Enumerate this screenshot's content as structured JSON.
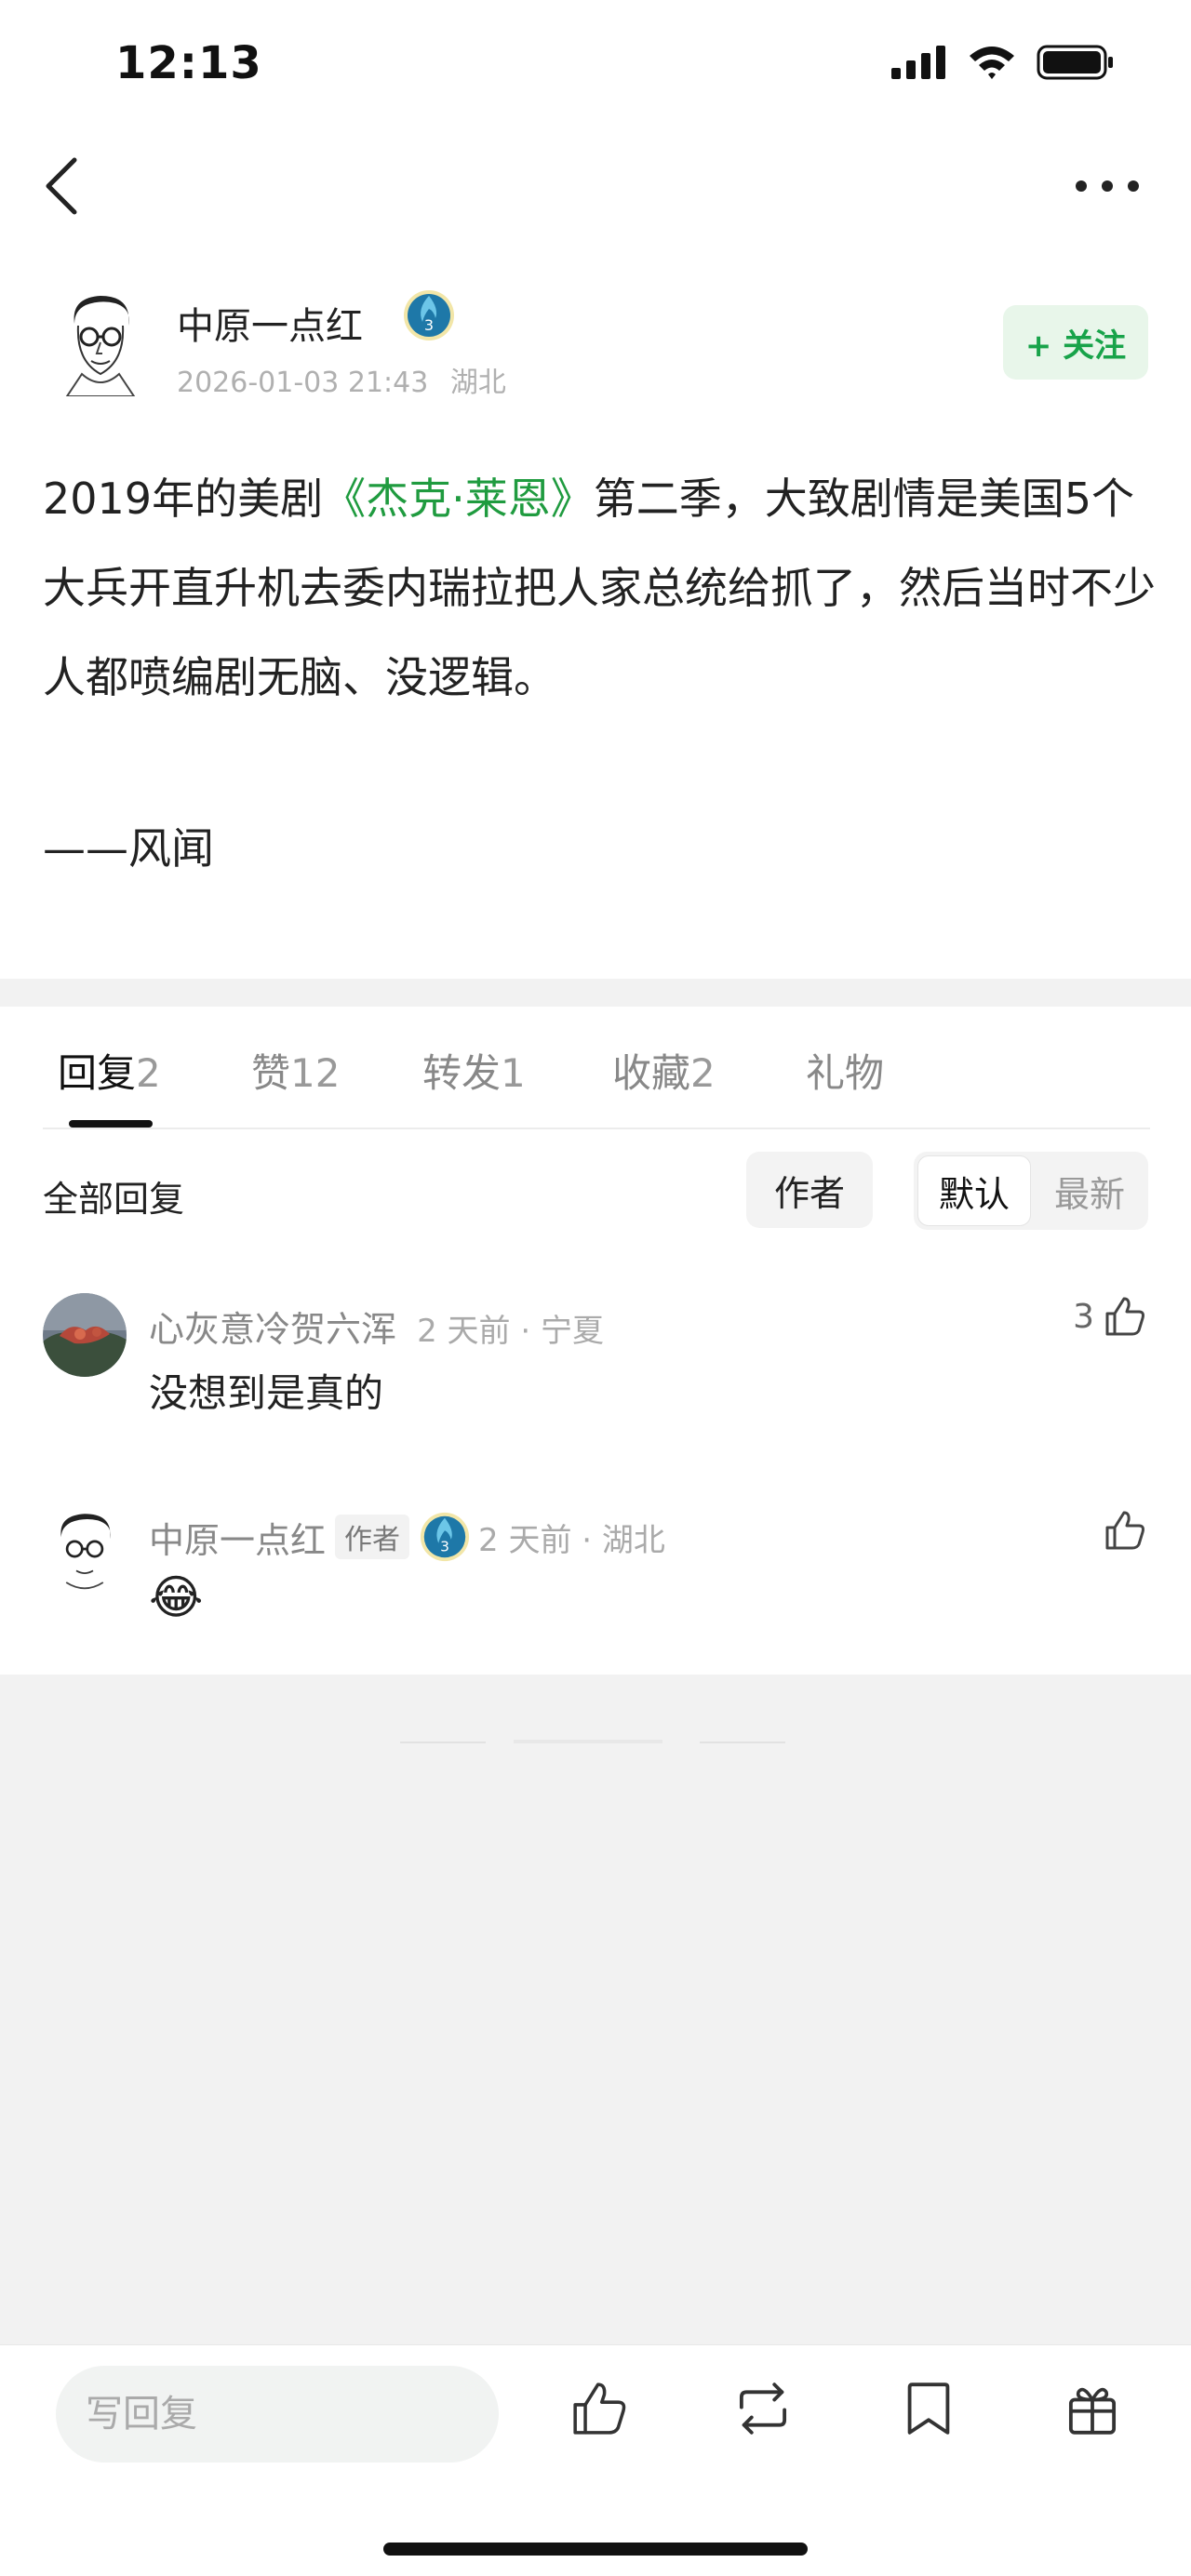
{
  "status_bar": {
    "time": "12:13"
  },
  "author": {
    "name": "中原一点红",
    "badge_level": "3",
    "date": "2026-01-03 21:43",
    "location": "湖北",
    "follow_label": "+ 关注"
  },
  "post": {
    "line1_prefix": "2019年的美剧",
    "book_title": "《杰克·莱恩》",
    "line1_suffix": "第二季，大致剧情是美国5个大兵开直升机去委内瑞拉把人家总统给抓了，然后当时不少人都喷编剧无脑、没逻辑。",
    "source": "——风闻"
  },
  "tabs": [
    {
      "label": "回复",
      "count": "2"
    },
    {
      "label": "赞",
      "count": "12"
    },
    {
      "label": "转发",
      "count": "1"
    },
    {
      "label": "收藏",
      "count": "2"
    },
    {
      "label": "礼物",
      "count": ""
    }
  ],
  "filter": {
    "all_label": "全部回复",
    "author_label": "作者",
    "sort_default": "默认",
    "sort_latest": "最新"
  },
  "comments": [
    {
      "name": "心灰意冷贺六浑",
      "meta": "2 天前 · 宁夏",
      "text": "没想到是真的",
      "likes": "3",
      "is_author": false
    },
    {
      "name": "中原一点红",
      "author_tag": "作者",
      "badge_level": "3",
      "meta": "2 天前 · 湖北",
      "text": "😂",
      "likes": "",
      "is_author": true
    }
  ],
  "bottom_bar": {
    "reply_placeholder": "写回复"
  },
  "colors": {
    "accent_green": "#1f9b3f",
    "follow_bg": "#e8f6ea",
    "gray_bg": "#f2f2f2"
  },
  "icons": [
    "back-icon",
    "more-icon",
    "signal-icon",
    "wifi-icon",
    "battery-icon",
    "like-icon",
    "repost-icon",
    "bookmark-icon",
    "gift-icon"
  ]
}
